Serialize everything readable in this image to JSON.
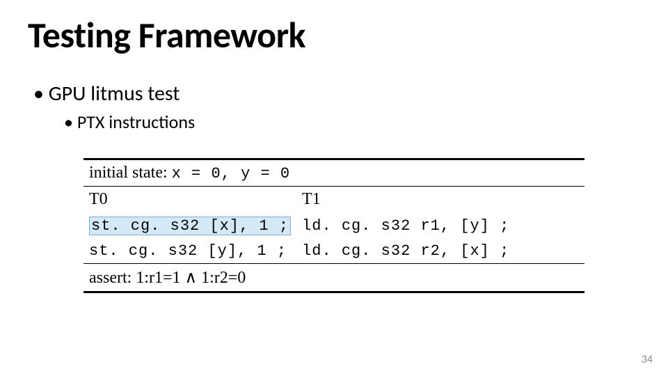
{
  "title": "Testing Framework",
  "bullets": {
    "item1": "GPU litmus test",
    "item2": "PTX instructions"
  },
  "litmus": {
    "initial_label": "initial state:",
    "initial_x": "x = 0, ",
    "initial_y": "y = 0",
    "t0": "T0",
    "t1": "T1",
    "t0_lines": {
      "l1": "st. cg. s32 [x], 1 ;",
      "l2": "st. cg. s32 [y], 1 ;"
    },
    "t1_lines": {
      "l1": "ld. cg. s32 r1, [y] ;",
      "l2": "ld. cg. s32 r2, [x] ;"
    },
    "assert_label": "assert:",
    "assert_expr_a": "1:r1=1",
    "assert_and": " ∧ ",
    "assert_expr_b": "1:r2=0"
  },
  "page_number": "34"
}
